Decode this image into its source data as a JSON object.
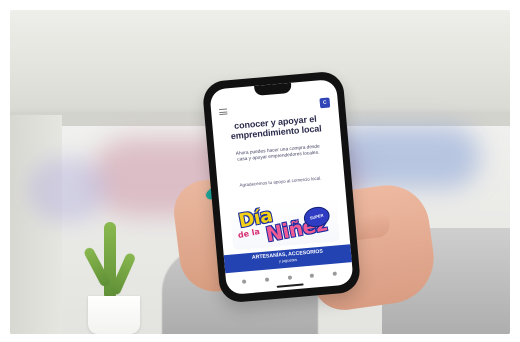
{
  "phone": {
    "status": {
      "time": "",
      "signal": ""
    },
    "browser": {
      "site_badge": "C"
    },
    "hero": {
      "title": "conocer y apoyar el emprendimiento local",
      "body_1": "Ahora puedes hacer una compra desde casa y apoyar emprendedores locales.",
      "body_2": "Agradecemos tu apoyo al comercio local."
    },
    "promo": {
      "word_main": "Día",
      "word_mid": "de la",
      "word_bottom": "Niñez",
      "seal": "SUPER"
    },
    "banner": {
      "title": "ARTESANÍAS, ACCESORIOS",
      "subtitle": "y juguetes"
    },
    "bottom_nav": {
      "items": [
        "",
        "",
        "",
        "",
        ""
      ]
    }
  }
}
